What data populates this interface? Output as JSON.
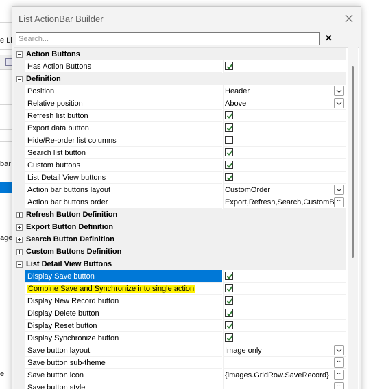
{
  "background": {
    "fragments": [
      "e Lis",
      "bar",
      "age",
      "e"
    ]
  },
  "dialog": {
    "title": "List ActionBar Builder",
    "search_placeholder": "Search...",
    "clear_search_glyph": "✕"
  },
  "grid": {
    "rows": [
      {
        "kind": "category",
        "label": "Action Buttons",
        "expanded": true
      },
      {
        "kind": "property",
        "label": "Has Action Buttons",
        "type": "checkbox",
        "checked": true
      },
      {
        "kind": "category",
        "label": "Definition",
        "expanded": true
      },
      {
        "kind": "property",
        "label": "Position",
        "type": "dropdown",
        "value": "Header"
      },
      {
        "kind": "property",
        "label": "Relative position",
        "type": "dropdown",
        "value": "Above"
      },
      {
        "kind": "property",
        "label": "Refresh list button",
        "type": "checkbox",
        "checked": true
      },
      {
        "kind": "property",
        "label": "Export data button",
        "type": "checkbox",
        "checked": true
      },
      {
        "kind": "property",
        "label": "Hide/Re-order list columns",
        "type": "checkbox",
        "checked": false
      },
      {
        "kind": "property",
        "label": "Search list button",
        "type": "checkbox",
        "checked": true
      },
      {
        "kind": "property",
        "label": "Custom buttons",
        "type": "checkbox",
        "checked": true
      },
      {
        "kind": "property",
        "label": "List Detail View buttons",
        "type": "checkbox",
        "checked": true
      },
      {
        "kind": "property",
        "label": "Action bar buttons layout",
        "type": "dropdown",
        "value": "CustomOrder"
      },
      {
        "kind": "property",
        "label": "Action bar buttons order",
        "type": "ellipsis",
        "value": "Export,Refresh,Search,CustomButtons"
      },
      {
        "kind": "category",
        "label": "Refresh Button Definition",
        "expanded": false
      },
      {
        "kind": "category",
        "label": "Export Button Definition",
        "expanded": false
      },
      {
        "kind": "category",
        "label": "Search Button Definition",
        "expanded": false
      },
      {
        "kind": "category",
        "label": "Custom Buttons Definition",
        "expanded": false
      },
      {
        "kind": "category",
        "label": "List Detail View Buttons",
        "expanded": true
      },
      {
        "kind": "property",
        "label": "Display Save button",
        "type": "checkbox",
        "checked": true,
        "selected": true
      },
      {
        "kind": "property",
        "label": "Combine Save and Synchronize into single action",
        "type": "checkbox",
        "checked": true,
        "highlighted": true
      },
      {
        "kind": "property",
        "label": "Display New Record button",
        "type": "checkbox",
        "checked": true
      },
      {
        "kind": "property",
        "label": "Display Delete button",
        "type": "checkbox",
        "checked": true
      },
      {
        "kind": "property",
        "label": "Display Reset button",
        "type": "checkbox",
        "checked": true
      },
      {
        "kind": "property",
        "label": "Display Synchronize button",
        "type": "checkbox",
        "checked": true
      },
      {
        "kind": "property",
        "label": "Save button layout",
        "type": "dropdown",
        "value": "Image only"
      },
      {
        "kind": "property",
        "label": "Save button sub-theme",
        "type": "ellipsis",
        "value": ""
      },
      {
        "kind": "property",
        "label": "Save button icon",
        "type": "ellipsis",
        "value": "{images.GridRow.SaveRecord}"
      },
      {
        "kind": "property",
        "label": "Save button style",
        "type": "ellipsis",
        "value": ""
      }
    ]
  },
  "colors": {
    "selection": "#0078d7",
    "highlight": "#fff200",
    "checkmark": "#2e7d32"
  }
}
